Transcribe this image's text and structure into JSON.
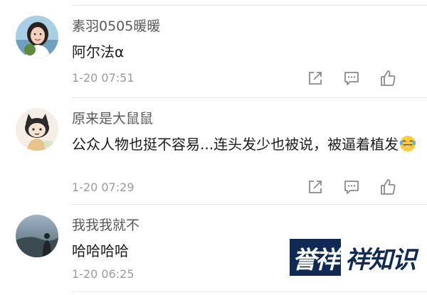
{
  "comments": [
    {
      "username": "素羽0505暖暖",
      "text": "阿尔法α",
      "time": "1-20 07:51",
      "has_emoji": false
    },
    {
      "username": "原来是大鼠鼠",
      "text": "公众人物也挺不容易...连头发少也被说，被逼着植发",
      "time": "1-20 07:29",
      "has_emoji": true,
      "emoji": "laughing-with-tears-emoji"
    },
    {
      "username": "我我我就不",
      "text": "哈哈哈哈",
      "time": "1-20 06:25",
      "has_emoji": false
    }
  ],
  "icons": {
    "share": "share-icon",
    "comment": "comment-icon",
    "like": "thumbs-up-icon"
  },
  "watermark": {
    "box_text": "誉祥",
    "text": "祥知识"
  },
  "colors": {
    "username": "#595959",
    "body_text": "#1a1a1a",
    "timestamp": "#9a9a9a",
    "icon": "#8a8a8a",
    "watermark": "#0e2a55"
  }
}
